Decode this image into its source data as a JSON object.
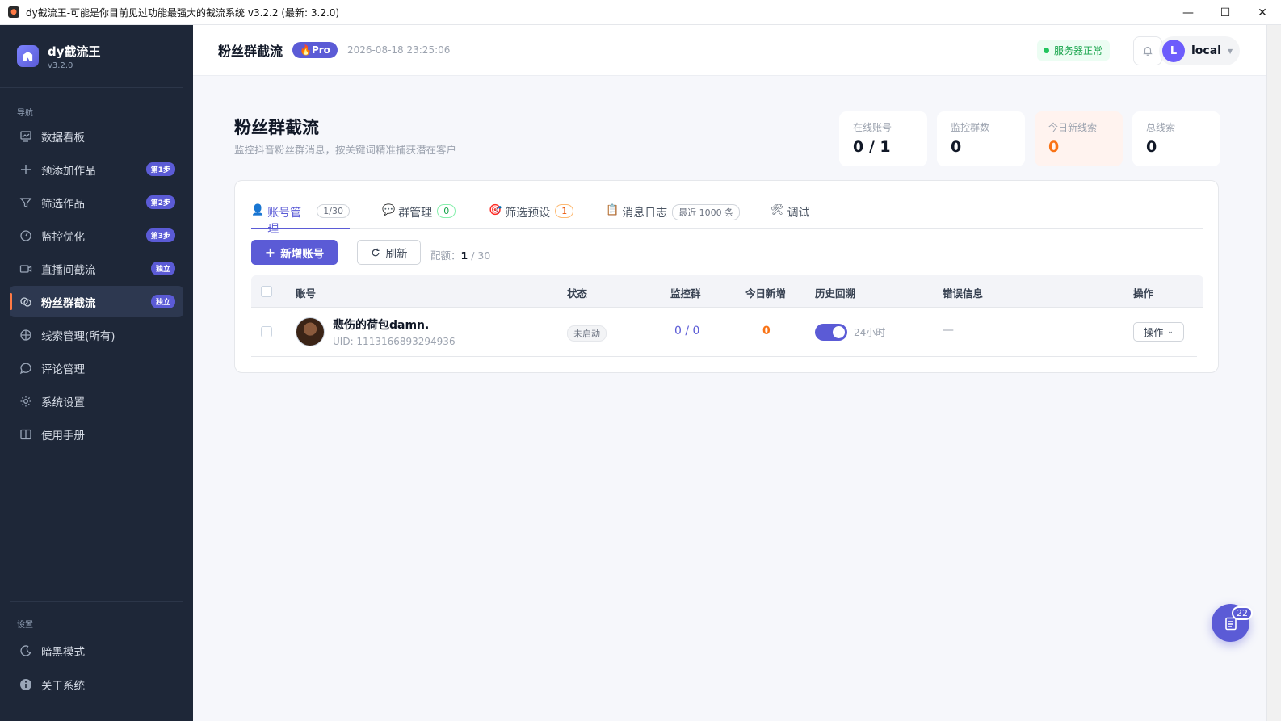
{
  "window": {
    "title": "dy截流王-可能是你目前见过功能最强大的截流系统 v3.2.2 (最新: 3.2.0)",
    "controls": [
      "—",
      "☐",
      "✕"
    ]
  },
  "brand": {
    "name": "dy截流王",
    "version": "v3.2.0"
  },
  "sidebar": {
    "nav_section": "导航",
    "items": [
      {
        "label": "数据看板",
        "icon": "dashboard-icon"
      },
      {
        "label": "预添加作品",
        "icon": "plus-icon",
        "badge": "第1步"
      },
      {
        "label": "筛选作品",
        "icon": "filter-icon",
        "badge": "第2步"
      },
      {
        "label": "监控优化",
        "icon": "monitor-icon",
        "badge": "第3步"
      },
      {
        "label": "直播间截流",
        "icon": "video-icon",
        "badge": "独立"
      },
      {
        "label": "粉丝群截流",
        "icon": "chat-icon",
        "badge": "独立",
        "active": true
      },
      {
        "label": "线索管理(所有)",
        "icon": "target-icon"
      },
      {
        "label": "评论管理",
        "icon": "comment-icon"
      },
      {
        "label": "系统设置",
        "icon": "gear-icon"
      },
      {
        "label": "使用手册",
        "icon": "book-icon"
      }
    ],
    "settings_section": "设置",
    "settings_items": [
      {
        "label": "暗黑模式",
        "icon": "moon-icon"
      },
      {
        "label": "关于系统",
        "icon": "info-icon"
      }
    ]
  },
  "header": {
    "title": "粉丝群截流",
    "pro_badge": "Pro",
    "datetime": "2026-08-18 23:25:06",
    "server_status": "服务器正常",
    "user_initial": "L",
    "user_name": "local"
  },
  "page": {
    "title": "粉丝群截流",
    "subtitle": "监控抖音粉丝群消息，按关键词精准捕获潜在客户"
  },
  "stats": [
    {
      "label": "在线账号",
      "value": "0 / 1"
    },
    {
      "label": "监控群数",
      "value": "0"
    },
    {
      "label": "今日新线索",
      "value": "0"
    },
    {
      "label": "总线索",
      "value": "0"
    }
  ],
  "tabs": [
    {
      "label": "账号管理",
      "count": "1/30",
      "icon": "user-icon"
    },
    {
      "label": "群管理",
      "count": "0",
      "icon": "group-chat-icon"
    },
    {
      "label": "筛选预设",
      "count": "1",
      "icon": "target-icon"
    },
    {
      "label": "消息日志",
      "count": "最近 1000 条",
      "icon": "clipboard-icon"
    },
    {
      "label": "调试",
      "icon": "tools-icon"
    }
  ],
  "toolbar": {
    "add_label": "新增账号",
    "refresh_label": "刷新",
    "quota_label": "配额：",
    "quota_used": "1",
    "quota_total": " / 30"
  },
  "table": {
    "headers": [
      "账号",
      "状态",
      "监控群",
      "今日新增",
      "历史回溯",
      "错误信息",
      "操作"
    ],
    "rows": [
      {
        "name": "悲伤的荷包damn.",
        "uid": "UID: 1113166893294936",
        "status": "未启动",
        "groups": "0 / 0",
        "today_new": "0",
        "history_enabled": true,
        "history_label": "24小时",
        "error": "—",
        "action": "操作"
      }
    ]
  },
  "float_button": {
    "badge": "22"
  },
  "colors": {
    "accent": "#5b5bd6",
    "sidebar_bg": "#1e2738",
    "highlight": "#f97316",
    "success": "#16a34a"
  }
}
